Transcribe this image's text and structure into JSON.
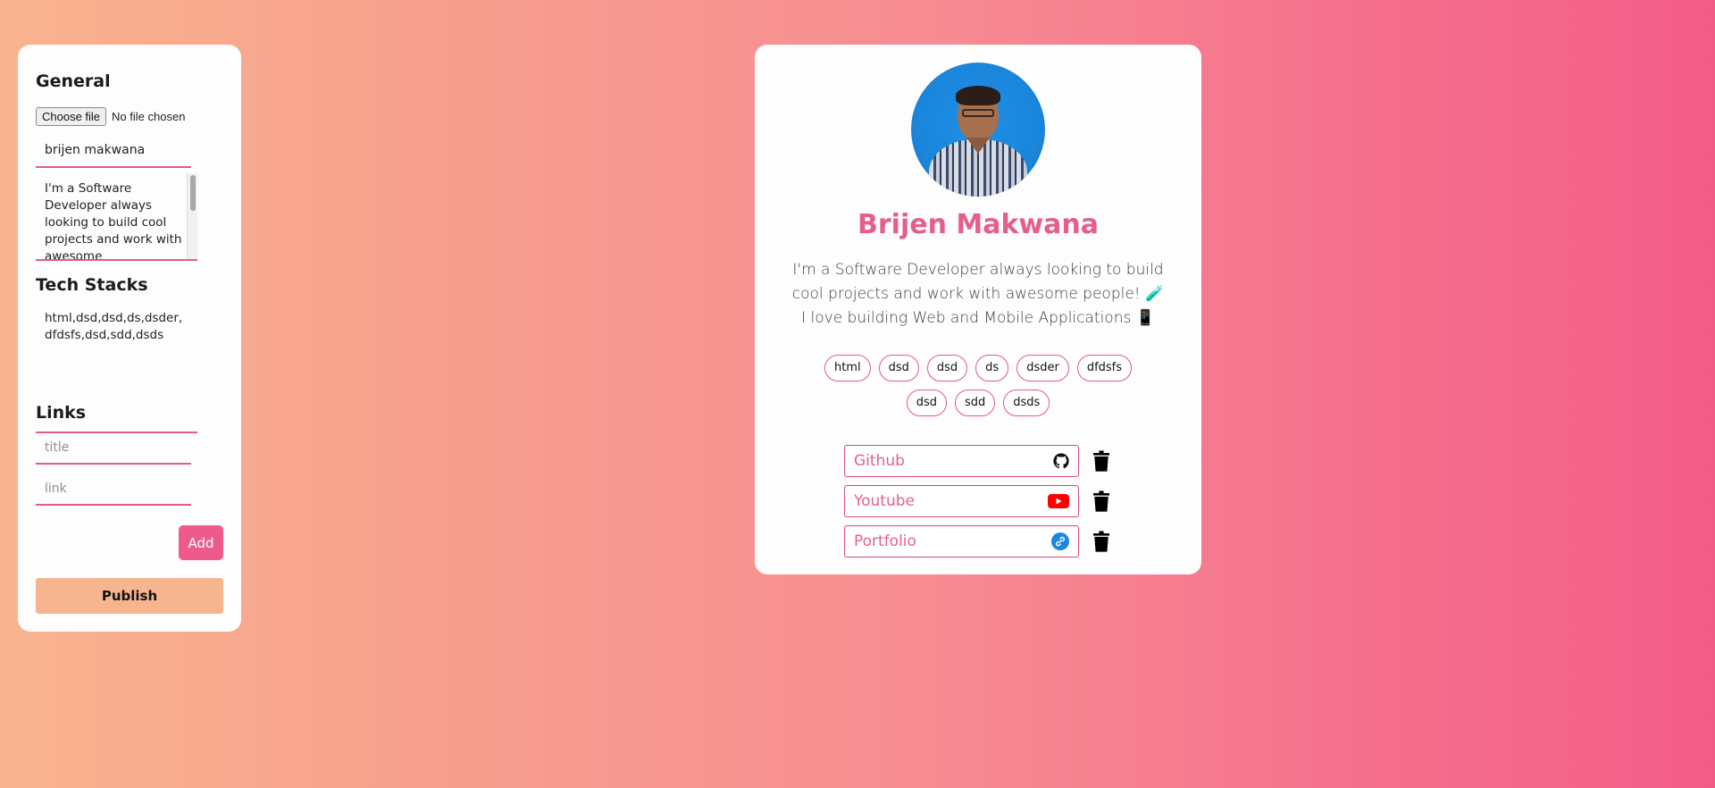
{
  "editor": {
    "general_heading": "General",
    "file_button": "Choose file",
    "file_status": "No file chosen",
    "name_value": "brijen makwana",
    "bio_value": "I'm a Software Developer always looking to build cool projects and work with awesome",
    "tech_heading": "Tech Stacks",
    "tech_value": "html,dsd,dsd,ds,dsder,dfdsfs,dsd,sdd,dsds",
    "links_heading": "Links",
    "title_placeholder": "title",
    "link_placeholder": "link",
    "add_label": "Add",
    "publish_label": "Publish"
  },
  "profile": {
    "name": "Brijen Makwana",
    "bio": "I'm a Software Developer always looking to build cool projects and work with awesome people! 🧪 I love building Web and Mobile Applications 📱",
    "tech": [
      "html",
      "dsd",
      "dsd",
      "ds",
      "dsder",
      "dfdsfs",
      "dsd",
      "sdd",
      "dsds"
    ],
    "links": [
      {
        "title": "Github",
        "icon": "github-icon"
      },
      {
        "title": "Youtube",
        "icon": "youtube-icon"
      },
      {
        "title": "Portfolio",
        "icon": "link-icon"
      }
    ]
  },
  "colors": {
    "accent": "#e45f8e",
    "add_button": "#ee5a8a",
    "publish_button": "#f7b58f",
    "youtube_red": "#ff0000",
    "link_blue": "#1a87e0"
  }
}
